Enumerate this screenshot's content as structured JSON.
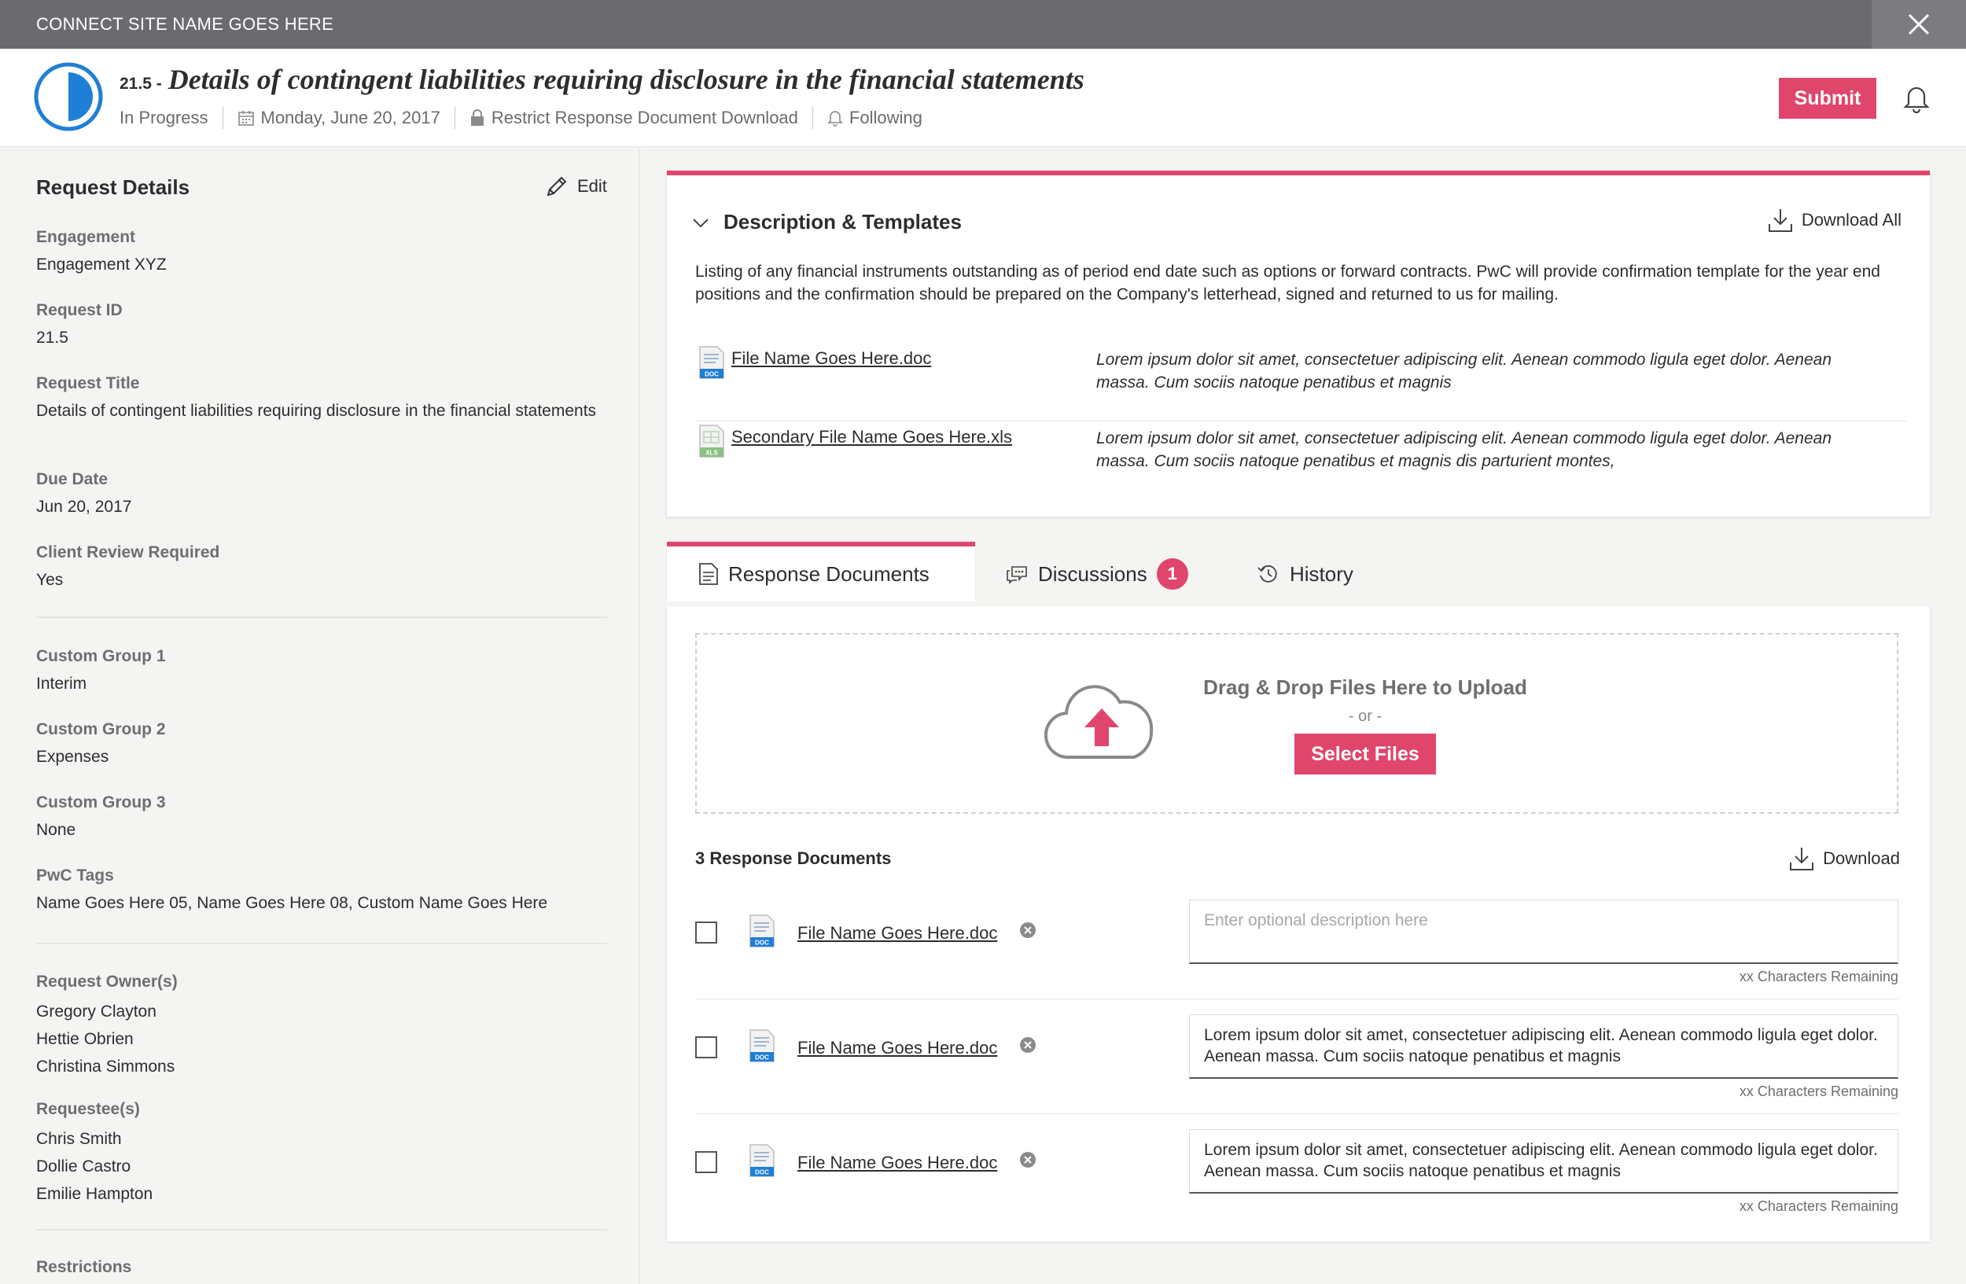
{
  "topbar": {
    "site_name": "CONNECT SITE NAME GOES HERE"
  },
  "header": {
    "request_number": "21.5 -",
    "title": "Details of contingent liabilities requiring disclosure in the financial statements",
    "status": "In Progress",
    "date": "Monday, June 20, 2017",
    "restrict": "Restrict Response Document Download",
    "following": "Following",
    "submit_label": "Submit"
  },
  "sidebar": {
    "title": "Request Details",
    "edit_label": "Edit",
    "fields": [
      {
        "label": "Engagement",
        "value": "Engagement XYZ"
      },
      {
        "label": "Request ID",
        "value": "21.5"
      },
      {
        "label": "Request Title",
        "value": "Details of contingent liabilities requiring disclosure in the financial statements"
      },
      {
        "label": "Due Date",
        "value": "Jun 20, 2017"
      },
      {
        "label": "Client Review Required",
        "value": "Yes"
      },
      {
        "label": "Custom Group 1",
        "value": "Interim"
      },
      {
        "label": "Custom Group 2",
        "value": "Expenses"
      },
      {
        "label": "Custom Group 3",
        "value": "None"
      },
      {
        "label": "PwC Tags",
        "value": "Name Goes Here 05, Name Goes Here 08, Custom Name Goes Here"
      }
    ],
    "owners": {
      "label": "Request Owner(s)",
      "names": [
        "Gregory Clayton",
        "Hettie Obrien",
        "Christina Simmons"
      ]
    },
    "requestees": {
      "label": "Requestee(s)",
      "names": [
        "Chris Smith",
        "Dollie Castro",
        "Emilie Hampton"
      ]
    },
    "restrictions_label": "Restrictions"
  },
  "description": {
    "title": "Description & Templates",
    "download_all": "Download All",
    "text": "Listing of any financial instruments outstanding as of period end date such as options or forward contracts. PwC will provide confirmation template for the year end positions and the confirmation should be prepared on the Company's letterhead, signed and returned to us for mailing.",
    "templates": [
      {
        "name": "File Name Goes Here.doc",
        "type": "DOC",
        "description": "Lorem ipsum dolor sit amet, consectetuer adipiscing elit. Aenean commodo ligula eget dolor. Aenean massa. Cum sociis natoque penatibus et magnis"
      },
      {
        "name": "Secondary File Name Goes Here.xls",
        "type": "XLS",
        "description": "Lorem ipsum dolor sit amet, consectetuer adipiscing elit. Aenean commodo ligula eget dolor. Aenean massa. Cum sociis natoque penatibus et magnis dis parturient montes,"
      }
    ]
  },
  "tabs": {
    "response_documents": "Response Documents",
    "discussions": "Discussions",
    "discussions_count": "1",
    "history": "History"
  },
  "upload": {
    "title": "Drag & Drop Files Here to Upload",
    "or": "- or -",
    "select_label": "Select Files"
  },
  "response_docs": {
    "count_label": "3 Response Documents",
    "download_label": "Download",
    "items": [
      {
        "name": "File Name Goes Here.doc",
        "type": "DOC",
        "description": "",
        "placeholder": "Enter optional description here",
        "remaining": "xx Characters Remaining"
      },
      {
        "name": "File Name Goes Here.doc",
        "type": "DOC",
        "description": "Lorem ipsum dolor sit amet, consectetuer adipiscing elit. Aenean commodo ligula eget dolor. Aenean massa. Cum sociis natoque penatibus et magnis",
        "placeholder": "",
        "remaining": "xx Characters Remaining"
      },
      {
        "name": "File Name Goes Here.doc",
        "type": "DOC",
        "description": "Lorem ipsum dolor sit amet, consectetuer adipiscing elit. Aenean commodo ligula eget dolor. Aenean massa. Cum sociis natoque penatibus et magnis",
        "placeholder": "",
        "remaining": "xx Characters Remaining"
      }
    ]
  },
  "colors": {
    "accent": "#e0466c",
    "status_blue": "#1f7fd6",
    "topbar": "#6b6b6f"
  },
  "icons": [
    "close-icon",
    "status-icon",
    "calendar-icon",
    "lock-icon",
    "bell-icon",
    "pencil-icon",
    "chevron-down-icon",
    "download-icon",
    "doc-file-icon",
    "xls-file-icon",
    "document-icon",
    "chat-icon",
    "history-icon",
    "cloud-upload-icon",
    "remove-icon"
  ]
}
